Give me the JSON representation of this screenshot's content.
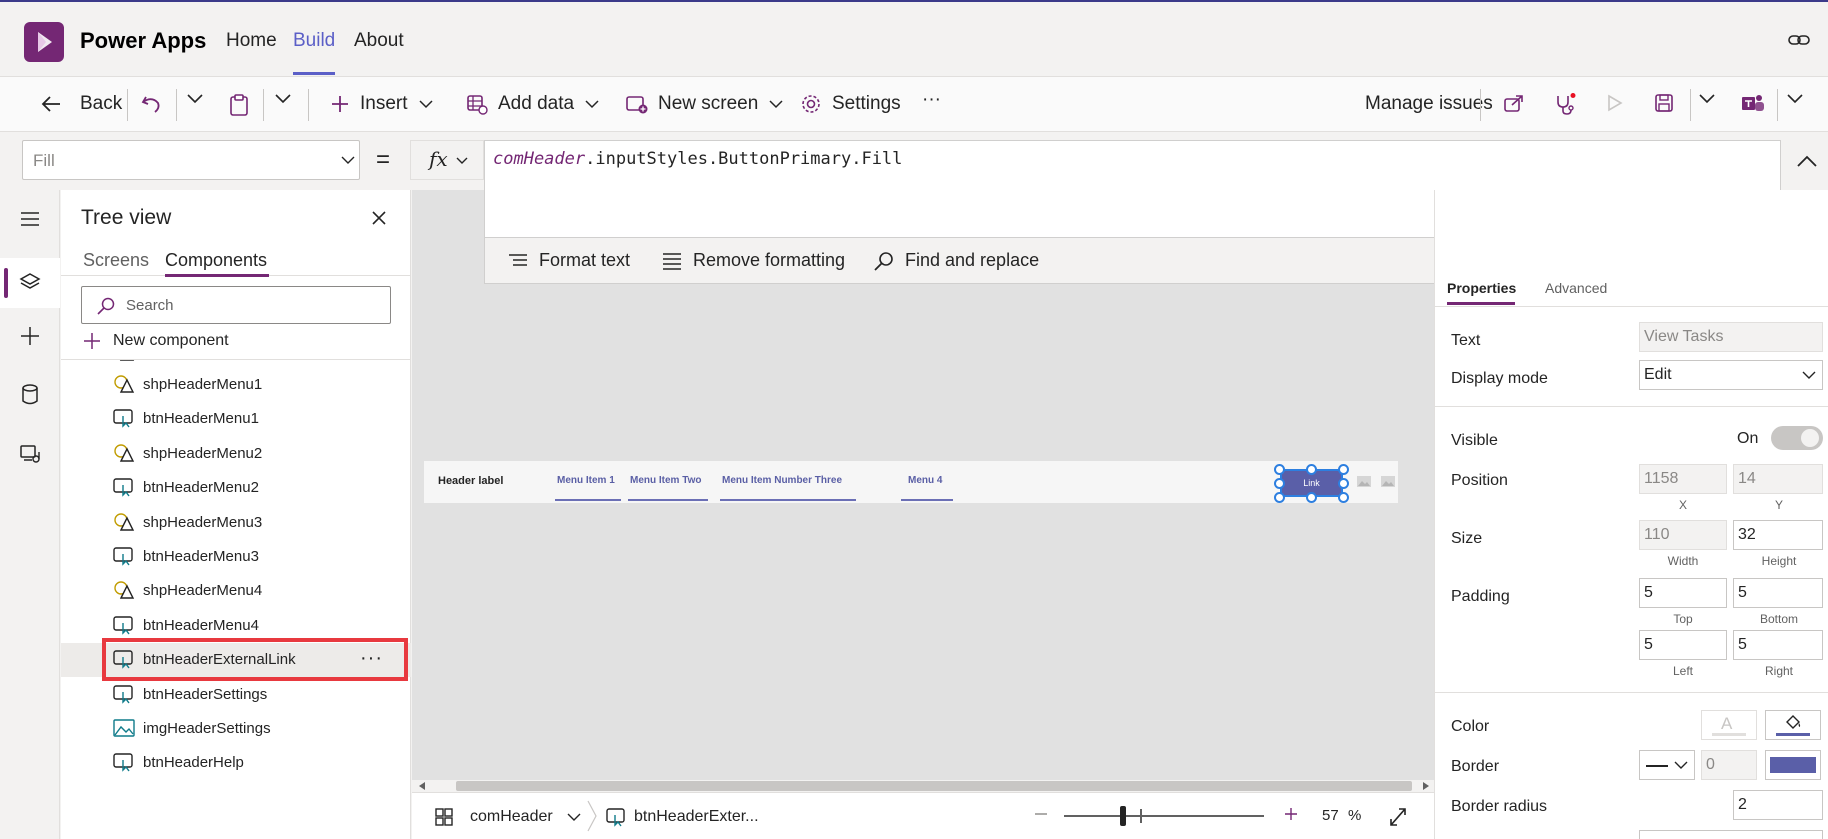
{
  "header": {
    "app_name": "Power Apps",
    "nav": [
      "Home",
      "Build",
      "About"
    ]
  },
  "toolbar": {
    "back": "Back",
    "insert": "Insert",
    "add_data": "Add data",
    "new_screen": "New screen",
    "settings": "Settings",
    "more": "···",
    "manage_issues": "Manage issues"
  },
  "formula_bar": {
    "property": "Fill",
    "equals": "=",
    "fx": "fx",
    "formula_object": "comHeader",
    "formula_rest": ".inputStyles.ButtonPrimary.Fill",
    "format_text": "Format text",
    "remove_formatting": "Remove formatting",
    "find_replace": "Find and replace"
  },
  "tree": {
    "title": "Tree view",
    "tabs": [
      "Screens",
      "Components"
    ],
    "search_placeholder": "Search",
    "new_component": "New component",
    "items": [
      {
        "label": "shpHeaderMenu1",
        "type": "shape"
      },
      {
        "label": "btnHeaderMenu1",
        "type": "button"
      },
      {
        "label": "shpHeaderMenu2",
        "type": "shape"
      },
      {
        "label": "btnHeaderMenu2",
        "type": "button"
      },
      {
        "label": "shpHeaderMenu3",
        "type": "shape"
      },
      {
        "label": "btnHeaderMenu3",
        "type": "button"
      },
      {
        "label": "shpHeaderMenu4",
        "type": "shape"
      },
      {
        "label": "btnHeaderMenu4",
        "type": "button"
      },
      {
        "label": "btnHeaderExternalLink",
        "type": "button",
        "selected": true
      },
      {
        "label": "btnHeaderSettings",
        "type": "button"
      },
      {
        "label": "imgHeaderSettings",
        "type": "image"
      },
      {
        "label": "btnHeaderHelp",
        "type": "button"
      }
    ],
    "item_more": "···"
  },
  "canvas": {
    "header_label": "Header label",
    "menu_items": [
      "Menu Item 1",
      "Menu Item Two",
      "Menu Item Number Three",
      "Menu 4"
    ],
    "link_button": "Link"
  },
  "status_bar": {
    "component": "comHeader",
    "control": "btnHeaderExter...",
    "zoom": "57",
    "zoom_unit": "%",
    "zoom_fraction": 0.57
  },
  "properties": {
    "tabs": [
      "Properties",
      "Advanced"
    ],
    "text_label": "Text",
    "text_value": "View Tasks",
    "display_mode_label": "Display mode",
    "display_mode_value": "Edit",
    "visible_label": "Visible",
    "visible_value": "On",
    "position_label": "Position",
    "position_x": "1158",
    "position_y": "14",
    "x_cap": "X",
    "y_cap": "Y",
    "size_label": "Size",
    "width": "110",
    "height": "32",
    "width_cap": "Width",
    "height_cap": "Height",
    "padding_label": "Padding",
    "pad_top": "5",
    "pad_bottom": "5",
    "pad_left": "5",
    "pad_right": "5",
    "top_cap": "Top",
    "bottom_cap": "Bottom",
    "left_cap": "Left",
    "right_cap": "Right",
    "color_label": "Color",
    "border_label": "Border",
    "border_width": "0",
    "border_radius_label": "Border radius",
    "border_radius": "2"
  },
  "colors": {
    "brand": "#742774",
    "accent": "#5b5fc7",
    "selection_outline": "#e8393f",
    "button_fill": "#5a5fa8"
  }
}
